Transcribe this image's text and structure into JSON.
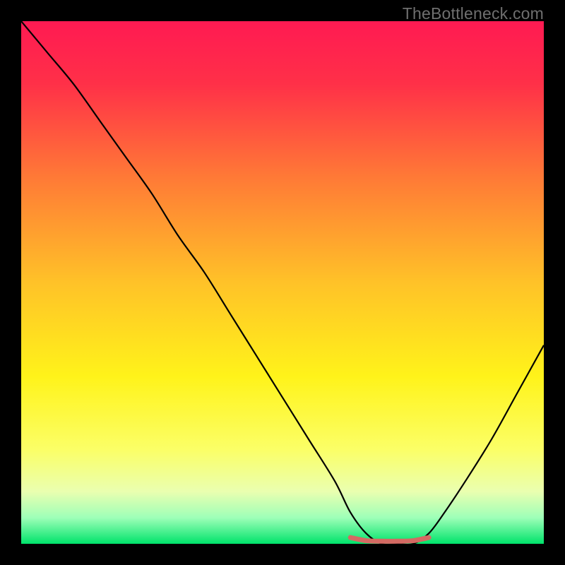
{
  "watermark": "TheBottleneck.com",
  "chart_data": {
    "type": "line",
    "title": "",
    "xlabel": "",
    "ylabel": "",
    "xlim": [
      0,
      100
    ],
    "ylim": [
      0,
      100
    ],
    "series": [
      {
        "name": "bottleneck-curve",
        "x": [
          0,
          5,
          10,
          15,
          20,
          25,
          30,
          35,
          40,
          45,
          50,
          55,
          60,
          63,
          66,
          69,
          72,
          75,
          78,
          81,
          85,
          90,
          95,
          100
        ],
        "values": [
          100,
          94,
          88,
          81,
          74,
          67,
          59,
          52,
          44,
          36,
          28,
          20,
          12,
          6,
          2,
          0,
          0,
          0,
          2,
          6,
          12,
          20,
          29,
          38
        ]
      },
      {
        "name": "optimal-range-marker",
        "x": [
          63,
          66,
          69,
          72,
          75,
          78
        ],
        "values": [
          1.2,
          0.6,
          0.5,
          0.5,
          0.6,
          1.2
        ]
      }
    ],
    "gradient_stops": [
      {
        "pct": 0,
        "color": "#ff1a52"
      },
      {
        "pct": 12,
        "color": "#ff3048"
      },
      {
        "pct": 30,
        "color": "#ff7a36"
      },
      {
        "pct": 50,
        "color": "#ffc228"
      },
      {
        "pct": 68,
        "color": "#fff31a"
      },
      {
        "pct": 82,
        "color": "#fbff67"
      },
      {
        "pct": 90,
        "color": "#eaffb0"
      },
      {
        "pct": 95,
        "color": "#9effb8"
      },
      {
        "pct": 100,
        "color": "#00e36b"
      }
    ],
    "colors": {
      "curve": "#000000",
      "marker": "#d46a63",
      "background_frame": "#000000"
    }
  }
}
